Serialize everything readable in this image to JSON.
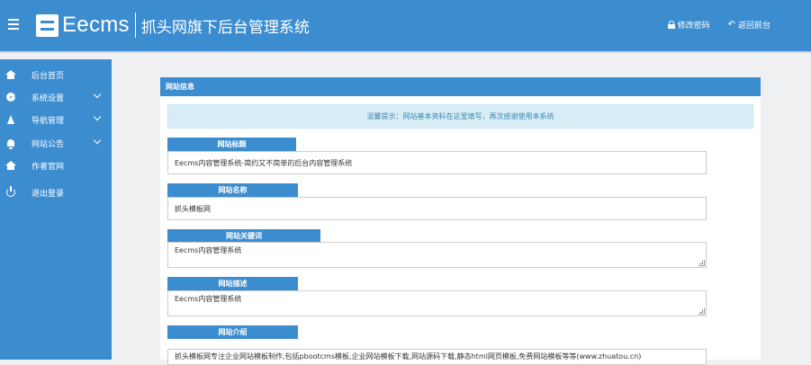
{
  "header": {
    "logo_name": "Eecms",
    "subtitle": "抓头网旗下后台管理系统",
    "change_password": "修改密码",
    "back_to_front": "返回前台"
  },
  "sidebar": {
    "items": [
      {
        "label": "后台首页",
        "icon": "home-icon"
      },
      {
        "label": "系统设置",
        "icon": "gear-icon"
      },
      {
        "label": "导航管理",
        "icon": "navigation-icon"
      },
      {
        "label": "网站公告",
        "icon": "bell-icon"
      },
      {
        "label": "作者官网",
        "icon": "home-icon"
      },
      {
        "label": "退出登录",
        "icon": "power-icon"
      }
    ]
  },
  "panel": {
    "title": "网站信息",
    "notice": "温馨提示：网站基本资料在这里填写，再次感谢使用本系统",
    "fields": [
      {
        "label": "网站标题",
        "value": "Eecms内容管理系统-简约又不简单的后台内容管理系统"
      },
      {
        "label": "网站名称",
        "value": "抓头模板网"
      },
      {
        "label": "网站关键词",
        "value": "Eecms内容管理系统"
      },
      {
        "label": "网站描述",
        "value": "Eecms内容管理系统"
      },
      {
        "label": "网站介绍",
        "value": "抓头模板网专注企业网站模板制作,包括pbootcms模板,企业网站模板下载,网站源码下载,静态html网页模板,免费网站模板等等(www.zhuatou.cn)"
      }
    ]
  },
  "colors": {
    "primary": "#3c8dd0",
    "alert_bg": "#d9edf7",
    "alert_text": "#3a87ad"
  }
}
